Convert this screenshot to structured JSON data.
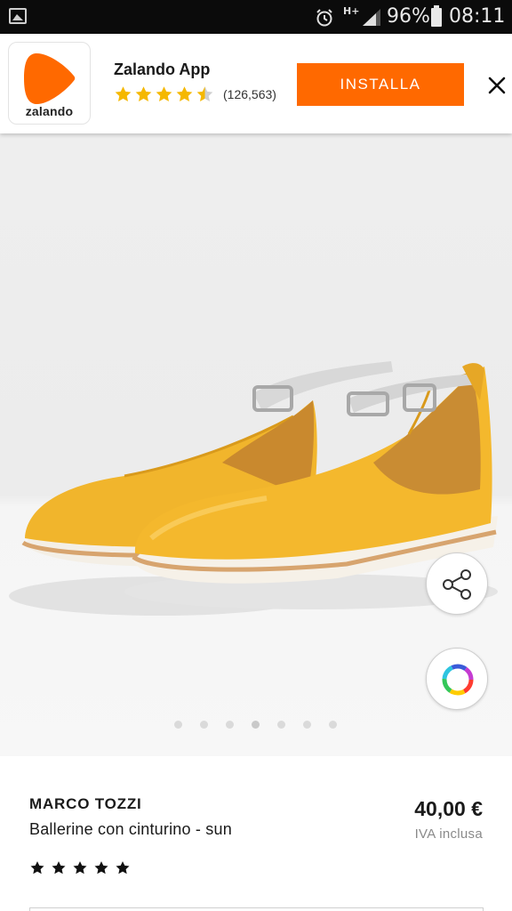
{
  "status_bar": {
    "icons": [
      "gallery-icon",
      "alarm-icon",
      "hplus-network-icon",
      "signal-icon",
      "battery-icon"
    ],
    "network_type": "H+",
    "battery_percent": "96%",
    "time": "08:11"
  },
  "app_banner": {
    "app_name": "Zalando App",
    "logo_text": "zalando",
    "rating_value": 4.5,
    "rating_max": 5,
    "review_count": "(126,563)",
    "install_label": "INSTALLA",
    "accent_color": "#ff6900",
    "star_color": "#f5b800"
  },
  "gallery": {
    "image_count": 7,
    "active_index": 3,
    "share_icon": "share-icon",
    "color_icon": "color-wheel-icon"
  },
  "product": {
    "brand": "MARCO TOZZI",
    "name": "Ballerine con cinturino - sun",
    "price": "40,00 €",
    "vat_note": "IVA inclusa",
    "rating_stars": 5
  }
}
